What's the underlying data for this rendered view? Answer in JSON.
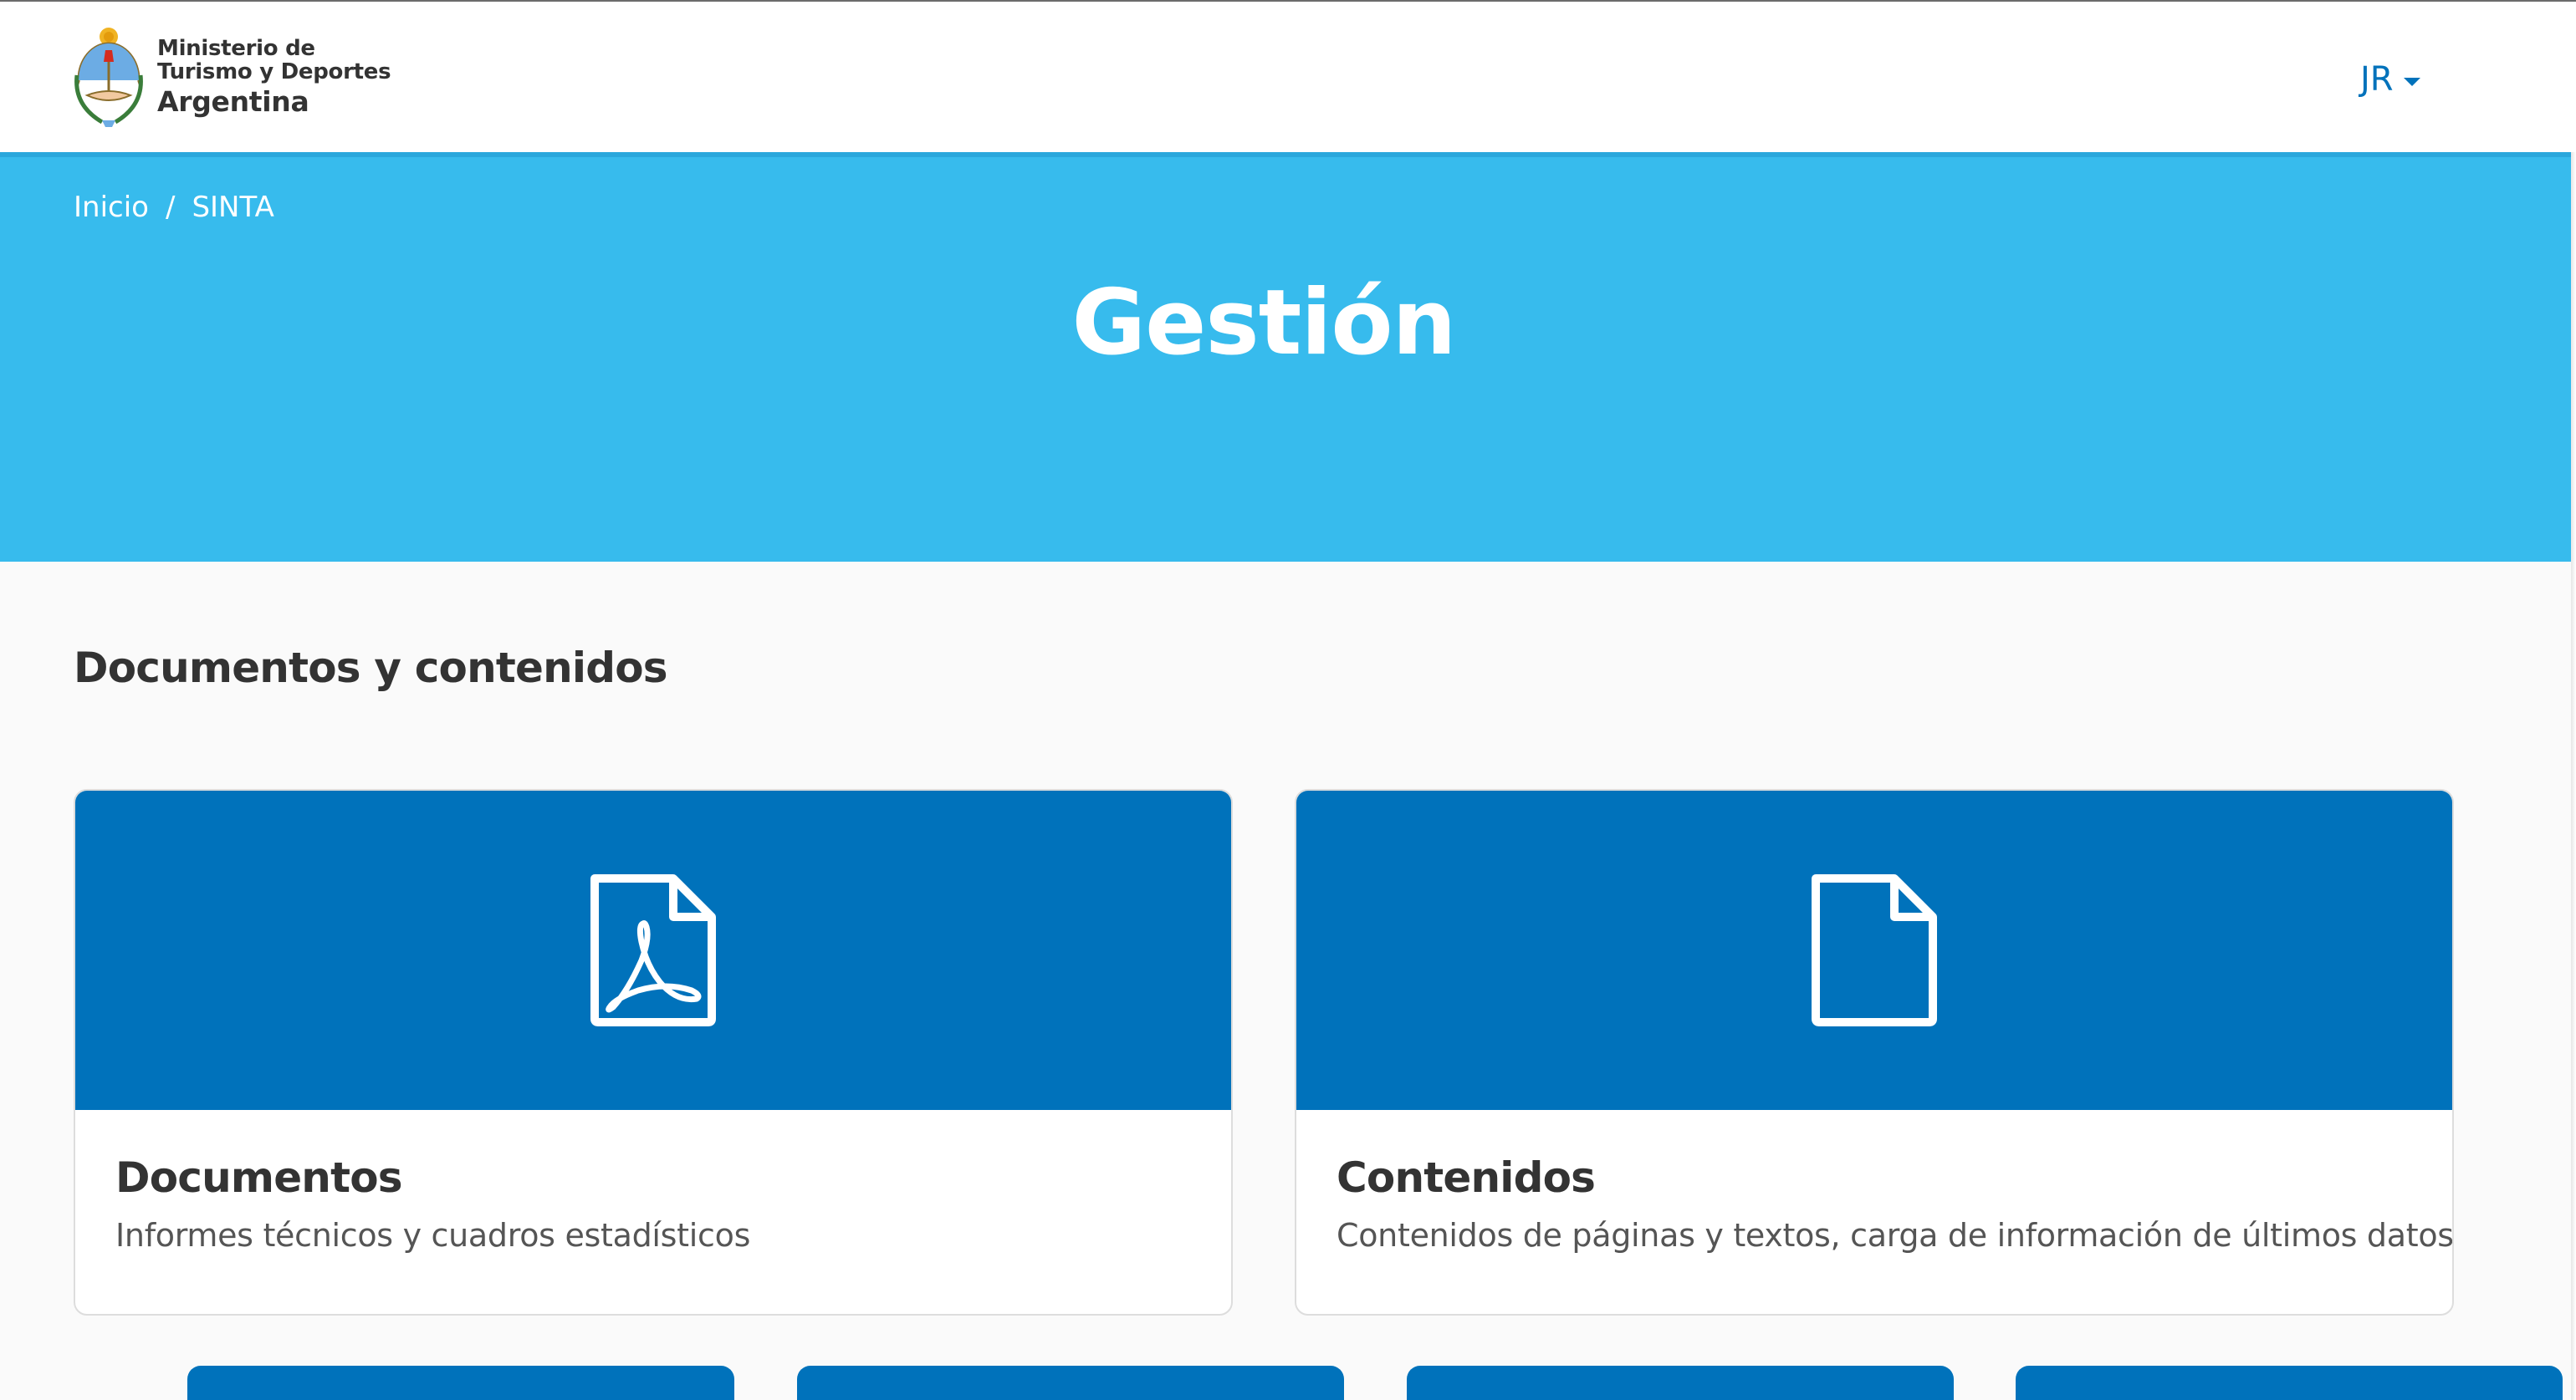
{
  "header": {
    "logo": {
      "line1": "Ministerio de",
      "line2": "Turismo y Deportes",
      "line3": "Argentina",
      "icon": "escudo-argentina-icon"
    },
    "user_initials": "JR",
    "user_menu_icon": "caret-down-icon"
  },
  "banner": {
    "breadcrumb": [
      {
        "label": "Inicio"
      },
      {
        "label": "SINTA"
      }
    ],
    "separator": "/",
    "title": "Gestión"
  },
  "section": {
    "title": "Documentos y contenidos",
    "cards": [
      {
        "title": "Documentos",
        "description": "Informes técnicos y cuadros estadísticos",
        "icon": "pdf-file-icon"
      },
      {
        "title": "Contenidos",
        "description": "Contenidos de páginas y textos, carga de información de últimos datos",
        "icon": "file-icon"
      }
    ]
  },
  "colors": {
    "banner": "#37bbed",
    "card_header": "#0072bb",
    "link": "#0072bb",
    "background": "#fafafa"
  }
}
